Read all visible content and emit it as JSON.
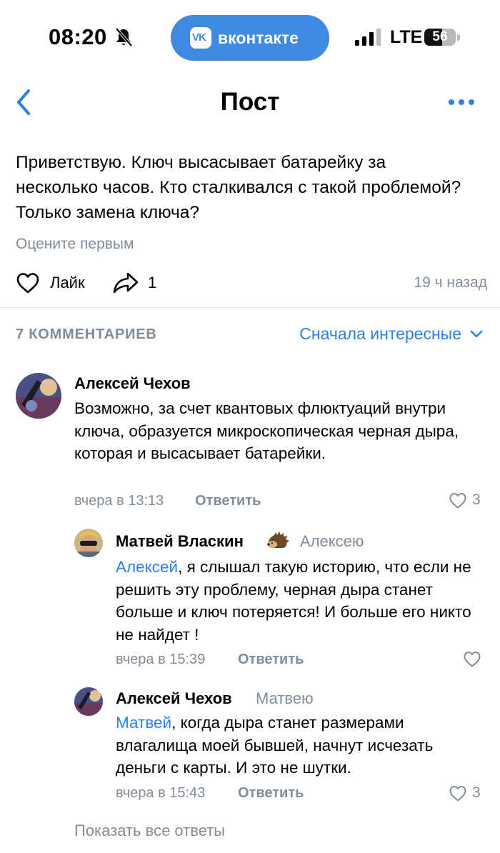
{
  "status_bar": {
    "time": "08:20",
    "app_pill_label": "вконтакте",
    "app_pill_logo": "VK",
    "network": "LTE",
    "battery_percent": "56",
    "battery_level": 0.56,
    "accent": "#3f8ae0"
  },
  "nav": {
    "title": "Пост",
    "back_icon": "chevron-left-icon",
    "more_icon": "more-horizontal-icon"
  },
  "post": {
    "text": "Приветствую. Ключ высасывает батарейку за несколько часов. Кто сталкивался с такой проблемой? Только замена ключа?",
    "rate_first": "Оцените первым",
    "like_label": "Лайк",
    "share_count": "1",
    "time": "19 ч назад"
  },
  "comments_header": {
    "count_label": "7 КОММЕНТАРИЕВ",
    "sort_label": "Сначала интересные"
  },
  "comments": [
    {
      "author": "Алексей Чехов",
      "reply_to": "",
      "mention": "",
      "text": "Возможно, за счет квантовых флюктуаций внутри ключа, образуется микроскопическая черная дыра, которая и высасывает батарейки.",
      "time": "вчера в 13:13",
      "reply_label": "Ответить",
      "likes": "3"
    },
    {
      "author": "Матвей Власкин",
      "reply_to": "Алексею",
      "mention": "Алексей",
      "text": ", я слышал такую историю, что если не решить эту проблему, черная дыра станет больше и ключ потеряется! И больше его никто не найдет !",
      "time": "вчера в 15:39",
      "reply_label": "Ответить",
      "likes": ""
    },
    {
      "author": "Алексей Чехов",
      "reply_to": "Матвею",
      "mention": "Матвей",
      "text": ", когда дыра станет размерами влагалища моей бывшей, начнут исчезать деньги с карты. И это не шутки.",
      "time": "вчера в 15:43",
      "reply_label": "Ответить",
      "likes": "3"
    }
  ],
  "show_all_replies": "Показать все ответы",
  "colors": {
    "link": "#2d81e0",
    "secondary_text": "#818c99",
    "divider": "#e2e4e8"
  }
}
